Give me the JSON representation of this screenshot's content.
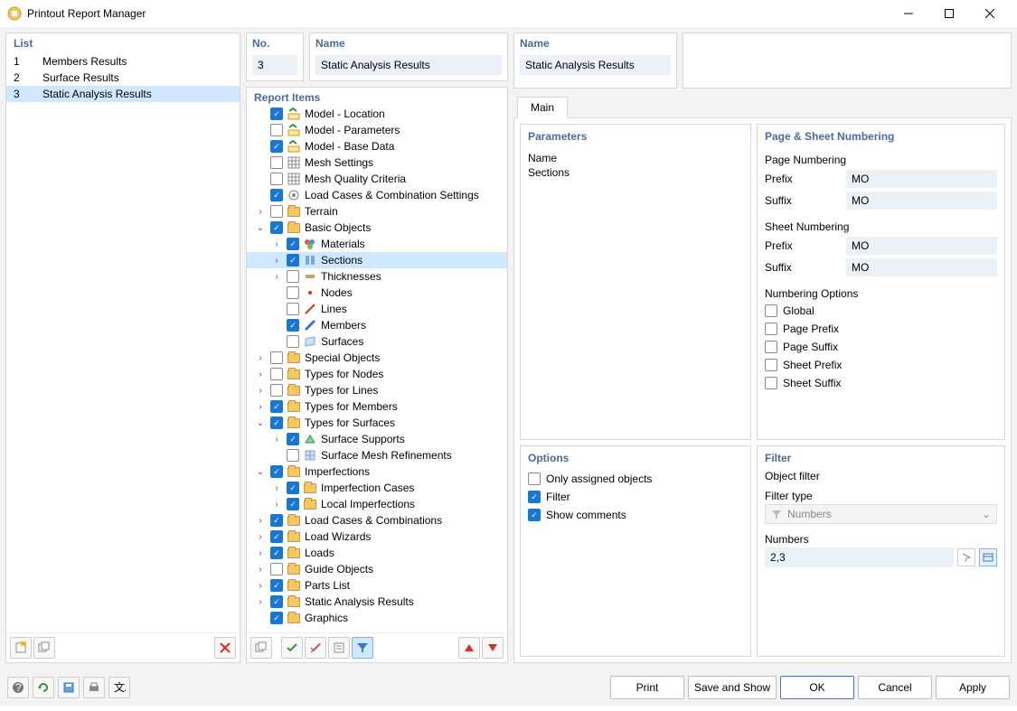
{
  "window": {
    "title": "Printout Report Manager"
  },
  "list": {
    "header": "List",
    "rows": [
      {
        "no": "1",
        "label": "Members Results"
      },
      {
        "no": "2",
        "label": "Surface Results"
      },
      {
        "no": "3",
        "label": "Static Analysis Results"
      }
    ],
    "selected_index": 2
  },
  "no_box": {
    "label": "No.",
    "value": "3"
  },
  "name_box": {
    "label": "Name",
    "value": "Static Analysis Results"
  },
  "tree": {
    "header": "Report Items",
    "nodes": [
      {
        "indent": 0,
        "arrow": "",
        "checked": true,
        "icon": "model",
        "label": "Model - Location"
      },
      {
        "indent": 0,
        "arrow": "",
        "checked": false,
        "icon": "model",
        "label": "Model - Parameters"
      },
      {
        "indent": 0,
        "arrow": "",
        "checked": true,
        "icon": "model",
        "label": "Model - Base Data"
      },
      {
        "indent": 0,
        "arrow": "",
        "checked": false,
        "icon": "mesh",
        "label": "Mesh Settings"
      },
      {
        "indent": 0,
        "arrow": "",
        "checked": false,
        "icon": "mesh",
        "label": "Mesh Quality Criteria"
      },
      {
        "indent": 0,
        "arrow": "",
        "checked": true,
        "icon": "setting",
        "label": "Load Cases & Combination Settings"
      },
      {
        "indent": 0,
        "arrow": "›",
        "checked": false,
        "icon": "folder",
        "label": "Terrain"
      },
      {
        "indent": 0,
        "arrow": "⌄",
        "checked": true,
        "icon": "folder",
        "label": "Basic Objects"
      },
      {
        "indent": 1,
        "arrow": "›",
        "checked": true,
        "icon": "mat",
        "label": "Materials"
      },
      {
        "indent": 1,
        "arrow": "›",
        "checked": true,
        "icon": "sect",
        "label": "Sections",
        "selected": true
      },
      {
        "indent": 1,
        "arrow": "›",
        "checked": false,
        "icon": "thick",
        "label": "Thicknesses"
      },
      {
        "indent": 1,
        "arrow": "",
        "checked": false,
        "icon": "node",
        "label": "Nodes"
      },
      {
        "indent": 1,
        "arrow": "",
        "checked": false,
        "icon": "line",
        "label": "Lines"
      },
      {
        "indent": 1,
        "arrow": "",
        "checked": true,
        "icon": "member",
        "label": "Members"
      },
      {
        "indent": 1,
        "arrow": "",
        "checked": false,
        "icon": "surface",
        "label": "Surfaces"
      },
      {
        "indent": 0,
        "arrow": "›",
        "checked": false,
        "icon": "folder",
        "label": "Special Objects"
      },
      {
        "indent": 0,
        "arrow": "›",
        "checked": false,
        "icon": "folder",
        "label": "Types for Nodes"
      },
      {
        "indent": 0,
        "arrow": "›",
        "checked": false,
        "icon": "folder",
        "label": "Types for Lines"
      },
      {
        "indent": 0,
        "arrow": "›",
        "checked": true,
        "icon": "folder",
        "label": "Types for Members"
      },
      {
        "indent": 0,
        "arrow": "⌄",
        "checked": true,
        "icon": "folder",
        "label": "Types for Surfaces"
      },
      {
        "indent": 1,
        "arrow": "›",
        "checked": true,
        "icon": "support",
        "label": "Surface Supports"
      },
      {
        "indent": 1,
        "arrow": "",
        "checked": false,
        "icon": "meshref",
        "label": "Surface Mesh Refinements"
      },
      {
        "indent": 0,
        "arrow": "⌄",
        "checked": true,
        "icon": "folder",
        "label": "Imperfections"
      },
      {
        "indent": 1,
        "arrow": "›",
        "checked": true,
        "icon": "folder",
        "label": "Imperfection Cases"
      },
      {
        "indent": 1,
        "arrow": "›",
        "checked": true,
        "icon": "folder",
        "label": "Local Imperfections"
      },
      {
        "indent": 0,
        "arrow": "›",
        "checked": true,
        "icon": "folder",
        "label": "Load Cases & Combinations"
      },
      {
        "indent": 0,
        "arrow": "›",
        "checked": true,
        "icon": "folder",
        "label": "Load Wizards"
      },
      {
        "indent": 0,
        "arrow": "›",
        "checked": true,
        "icon": "folder",
        "label": "Loads"
      },
      {
        "indent": 0,
        "arrow": "›",
        "checked": false,
        "icon": "folder",
        "label": "Guide Objects"
      },
      {
        "indent": 0,
        "arrow": "›",
        "checked": true,
        "icon": "folder",
        "label": "Parts List"
      },
      {
        "indent": 0,
        "arrow": "›",
        "checked": true,
        "icon": "folder",
        "label": "Static Analysis Results"
      },
      {
        "indent": 0,
        "arrow": "",
        "checked": true,
        "icon": "folder",
        "label": "Graphics"
      }
    ]
  },
  "tab": {
    "main": "Main"
  },
  "parameters": {
    "title": "Parameters",
    "name_label": "Name",
    "name_value": "Sections"
  },
  "numbering": {
    "title": "Page & Sheet Numbering",
    "page_head": "Page Numbering",
    "sheet_head": "Sheet Numbering",
    "prefix_label": "Prefix",
    "suffix_label": "Suffix",
    "page_prefix": "MO",
    "page_suffix": "MO",
    "sheet_prefix": "MO",
    "sheet_suffix": "MO",
    "options_head": "Numbering Options",
    "opts": {
      "global": "Global",
      "page_prefix": "Page Prefix",
      "page_suffix": "Page Suffix",
      "sheet_prefix": "Sheet Prefix",
      "sheet_suffix": "Sheet Suffix"
    }
  },
  "options": {
    "title": "Options",
    "only_assigned": "Only assigned objects",
    "filter": "Filter",
    "show_comments": "Show comments"
  },
  "filter": {
    "title": "Filter",
    "obj_filter_label": "Object filter",
    "type_label": "Filter type",
    "type_value": "Numbers",
    "numbers_label": "Numbers",
    "numbers_value": "2,3"
  },
  "buttons": {
    "print": "Print",
    "save_show": "Save and Show",
    "ok": "OK",
    "cancel": "Cancel",
    "apply": "Apply"
  }
}
